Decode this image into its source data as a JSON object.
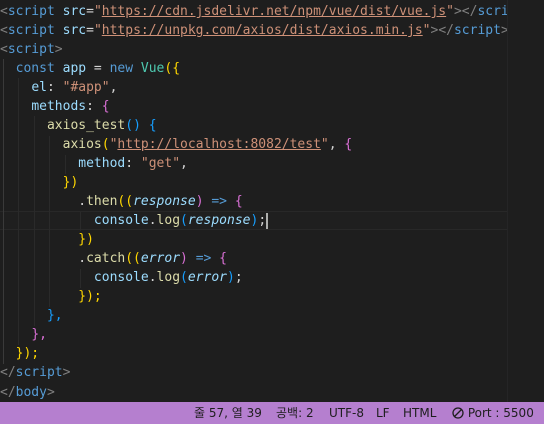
{
  "code_lines": [
    {
      "tokens": [
        {
          "t": "<",
          "c": "p"
        },
        {
          "t": "script",
          "c": "t"
        },
        {
          "t": " ",
          "c": ""
        },
        {
          "t": "src",
          "c": "a"
        },
        {
          "t": "=",
          "c": ""
        },
        {
          "t": "\"",
          "c": "s"
        },
        {
          "t": "https://cdn.jsdelivr.net/npm/vue/dist/vue.js",
          "c": "s u"
        },
        {
          "t": "\"",
          "c": "s"
        },
        {
          "t": "></",
          "c": "p"
        },
        {
          "t": "scrip",
          "c": "t"
        }
      ]
    },
    {
      "tokens": [
        {
          "t": "<",
          "c": "p"
        },
        {
          "t": "script",
          "c": "t"
        },
        {
          "t": " ",
          "c": ""
        },
        {
          "t": "src",
          "c": "a"
        },
        {
          "t": "=",
          "c": ""
        },
        {
          "t": "\"",
          "c": "s"
        },
        {
          "t": "https://unpkg.com/axios/dist/axios.min.js",
          "c": "s u"
        },
        {
          "t": "\"",
          "c": "s"
        },
        {
          "t": "></",
          "c": "p"
        },
        {
          "t": "script",
          "c": "t"
        },
        {
          "t": ">",
          "c": "p"
        }
      ]
    },
    {
      "tokens": [
        {
          "t": "<",
          "c": "p"
        },
        {
          "t": "script",
          "c": "t"
        },
        {
          "t": ">",
          "c": "p"
        }
      ]
    },
    {
      "tokens": [
        {
          "t": "  ",
          "c": ""
        },
        {
          "t": "const",
          "c": "k"
        },
        {
          "t": " ",
          "c": ""
        },
        {
          "t": "app",
          "c": "v"
        },
        {
          "t": " = ",
          "c": ""
        },
        {
          "t": "new",
          "c": "k"
        },
        {
          "t": " ",
          "c": ""
        },
        {
          "t": "Vue",
          "c": "c"
        },
        {
          "t": "({",
          "c": "b1"
        }
      ]
    },
    {
      "tokens": [
        {
          "t": "    ",
          "c": ""
        },
        {
          "t": "el",
          "c": "v"
        },
        {
          "t": ": ",
          "c": ""
        },
        {
          "t": "\"#app\"",
          "c": "s"
        },
        {
          "t": ",",
          "c": ""
        }
      ]
    },
    {
      "tokens": [
        {
          "t": "    ",
          "c": ""
        },
        {
          "t": "methods",
          "c": "v"
        },
        {
          "t": ": ",
          "c": ""
        },
        {
          "t": "{",
          "c": "b2"
        }
      ]
    },
    {
      "tokens": [
        {
          "t": "      ",
          "c": ""
        },
        {
          "t": "axios_test",
          "c": "f"
        },
        {
          "t": "() ",
          "c": "b3"
        },
        {
          "t": "{",
          "c": "b3"
        }
      ]
    },
    {
      "tokens": [
        {
          "t": "        ",
          "c": ""
        },
        {
          "t": "axios",
          "c": "f"
        },
        {
          "t": "(",
          "c": "b1"
        },
        {
          "t": "\"",
          "c": "s"
        },
        {
          "t": "http://localhost:8082/test",
          "c": "s u"
        },
        {
          "t": "\"",
          "c": "s"
        },
        {
          "t": ", ",
          "c": ""
        },
        {
          "t": "{",
          "c": "b2"
        }
      ]
    },
    {
      "tokens": [
        {
          "t": "          ",
          "c": ""
        },
        {
          "t": "method",
          "c": "v"
        },
        {
          "t": ": ",
          "c": ""
        },
        {
          "t": "\"get\"",
          "c": "s"
        },
        {
          "t": ",",
          "c": ""
        }
      ]
    },
    {
      "tokens": [
        {
          "t": "        ",
          "c": ""
        },
        {
          "t": "})",
          "c": "b1"
        }
      ]
    },
    {
      "tokens": [
        {
          "t": "          .",
          "c": ""
        },
        {
          "t": "then",
          "c": "f"
        },
        {
          "t": "((",
          "c": "b1"
        },
        {
          "t": "response",
          "c": "i"
        },
        {
          "t": ") ",
          "c": "b2"
        },
        {
          "t": "=>",
          "c": "k"
        },
        {
          "t": " ",
          "c": ""
        },
        {
          "t": "{",
          "c": "b2"
        }
      ]
    },
    {
      "tokens": [
        {
          "t": "            ",
          "c": ""
        },
        {
          "t": "console",
          "c": "v"
        },
        {
          "t": ".",
          "c": ""
        },
        {
          "t": "log",
          "c": "f"
        },
        {
          "t": "(",
          "c": "b3"
        },
        {
          "t": "response",
          "c": "i"
        },
        {
          "t": ")",
          "c": "b3"
        },
        {
          "t": ";",
          "c": ""
        }
      ]
    },
    {
      "tokens": [
        {
          "t": "          ",
          "c": ""
        },
        {
          "t": "})",
          "c": "b1"
        }
      ]
    },
    {
      "tokens": [
        {
          "t": "          .",
          "c": ""
        },
        {
          "t": "catch",
          "c": "f"
        },
        {
          "t": "((",
          "c": "b1"
        },
        {
          "t": "error",
          "c": "i"
        },
        {
          "t": ") ",
          "c": "b2"
        },
        {
          "t": "=>",
          "c": "k"
        },
        {
          "t": " ",
          "c": ""
        },
        {
          "t": "{",
          "c": "b2"
        }
      ]
    },
    {
      "tokens": [
        {
          "t": "            ",
          "c": ""
        },
        {
          "t": "console",
          "c": "v"
        },
        {
          "t": ".",
          "c": ""
        },
        {
          "t": "log",
          "c": "f"
        },
        {
          "t": "(",
          "c": "b3"
        },
        {
          "t": "error",
          "c": "i"
        },
        {
          "t": ")",
          "c": "b3"
        },
        {
          "t": ";",
          "c": ""
        }
      ]
    },
    {
      "tokens": [
        {
          "t": "          ",
          "c": ""
        },
        {
          "t": "});",
          "c": "b1"
        }
      ]
    },
    {
      "tokens": [
        {
          "t": "      ",
          "c": ""
        },
        {
          "t": "},",
          "c": "b3"
        }
      ]
    },
    {
      "tokens": [
        {
          "t": "    ",
          "c": ""
        },
        {
          "t": "},",
          "c": "b2"
        }
      ]
    },
    {
      "tokens": [
        {
          "t": "  ",
          "c": ""
        },
        {
          "t": "});",
          "c": "b1"
        }
      ]
    },
    {
      "tokens": [
        {
          "t": "</",
          "c": "p"
        },
        {
          "t": "script",
          "c": "t"
        },
        {
          "t": ">",
          "c": "p"
        }
      ]
    }
  ],
  "body_tag": {
    "open": "</",
    "name": "body",
    "close": ">"
  },
  "status_bar": {
    "position": "줄 57, 열 39",
    "spaces": "공백: 2",
    "encoding": "UTF-8",
    "eol": "LF",
    "language": "HTML",
    "port": "Port : 5500",
    "port_icon": "no-entry-icon"
  },
  "colors": {
    "status_bar_bg": "#b57fcf",
    "editor_bg": "#1e1e1e"
  }
}
